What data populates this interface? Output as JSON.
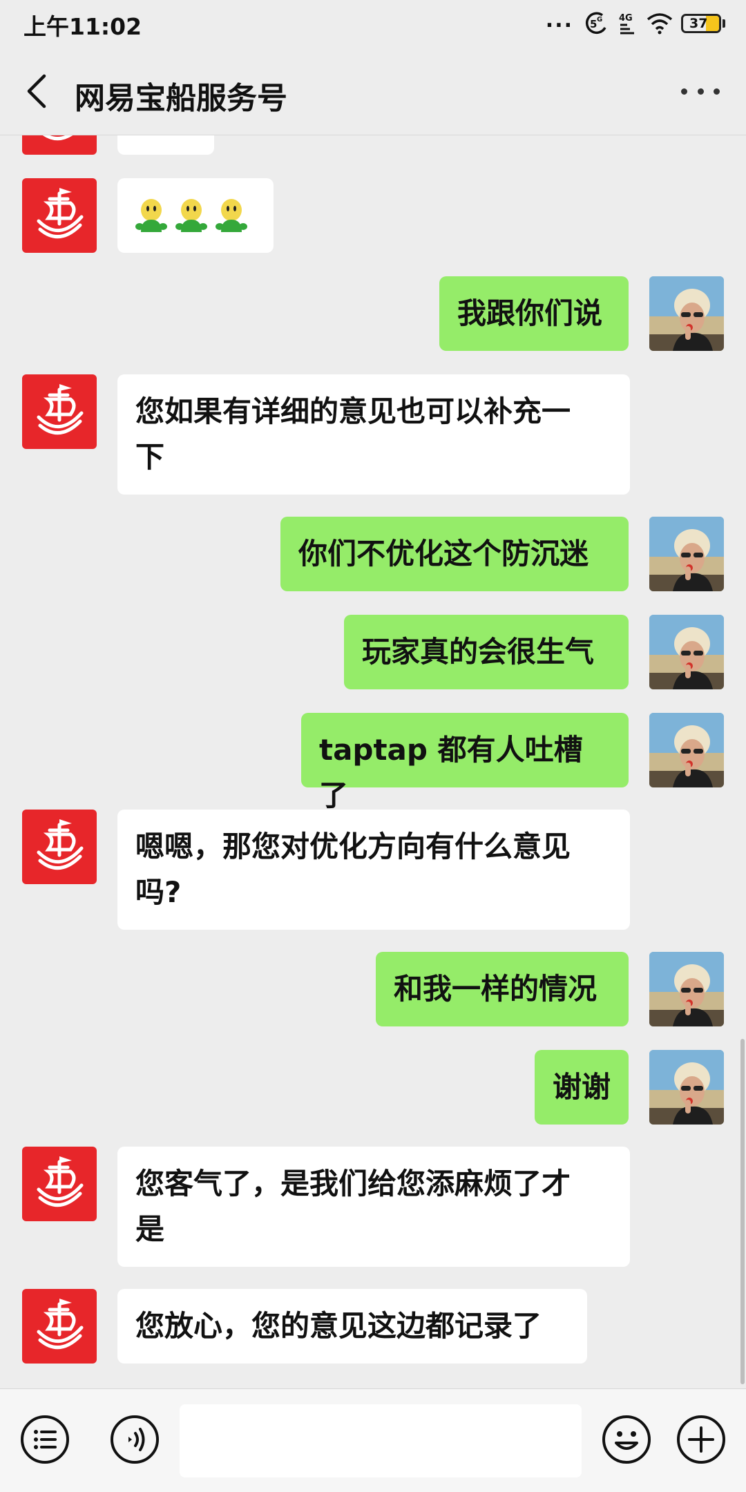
{
  "status_bar": {
    "time": "上午11:02",
    "dots": "...",
    "signal_label": "4G",
    "battery_level": "37",
    "battery_fraction": 0.37,
    "battery_color": "#f5c41c"
  },
  "header": {
    "title": "网易宝船服务号",
    "back_icon": "chevron-left-icon",
    "more_icon": "more-dots-icon"
  },
  "chat": {
    "brand_color": "#e7262a",
    "incoming_bubble_color": "#ffffff",
    "outgoing_bubble_color": "#95ec69",
    "messages": [
      {
        "side": "in",
        "text": ""
      },
      {
        "side": "in",
        "text": "",
        "emoji": "green-figure-emoji",
        "emoji_count": 3
      },
      {
        "side": "out",
        "text": "我跟你们说"
      },
      {
        "side": "in",
        "lines": [
          "您如果有详细的意见也可以补充一",
          "下"
        ]
      },
      {
        "side": "out",
        "text": "你们不优化这个防沉迷"
      },
      {
        "side": "out",
        "text": "玩家真的会很生气"
      },
      {
        "side": "out",
        "text": "taptap 都有人吐槽了"
      },
      {
        "side": "in",
        "lines": [
          "嗯嗯，那您对优化方向有什么意见",
          "吗?"
        ]
      },
      {
        "side": "out",
        "text": "和我一样的情况"
      },
      {
        "side": "out",
        "text": "谢谢"
      },
      {
        "side": "in",
        "lines": [
          "您客气了，是我们给您添麻烦了才",
          "是"
        ]
      },
      {
        "side": "in",
        "text": "您放心，您的意见这边都记录了"
      }
    ]
  },
  "input_bar": {
    "menu_icon": "menu-list-icon",
    "voice_icon": "voice-icon",
    "input_placeholder": "",
    "emoji_icon": "smiley-icon",
    "add_icon": "plus-icon"
  }
}
